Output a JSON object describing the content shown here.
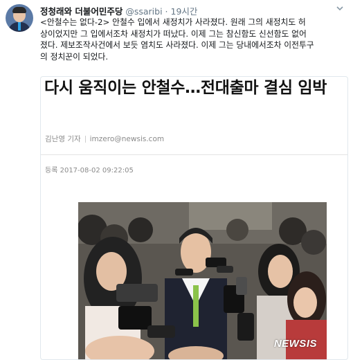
{
  "tweet": {
    "author_name": "정청래와 더불어민주당",
    "handle": "@ssaribi",
    "separator": "·",
    "time": "19시간",
    "text": "<안철수는 없다-2> 안철수 입에서 새정치가 사라졌다. 원래 그의 새정치도 허\n상이었지만 그 입에서조차 새정치가 떠났다. 이제 그는 참신함도 신선함도 없어\n졌다. 제보조작사건에서 보듯 염치도 사라졌다. 이제 그는 당내에서조차 이전투구\n의 정치꾼이 되었다."
  },
  "card": {
    "headline": "다시 움직이는 안철수…전대출마 결심 임박",
    "reporter": "김난영 기자",
    "email": "imzero@newsis.com",
    "date_label": "등록",
    "date": "2017-08-02 09:22:05",
    "photo_credit": "NEWSIS"
  },
  "icons": {
    "menu": "chevron-down-icon"
  },
  "colors": {
    "text_primary": "#14171a",
    "text_secondary": "#657786",
    "border": "#e1e8ed",
    "tie": "#8bc34a"
  }
}
